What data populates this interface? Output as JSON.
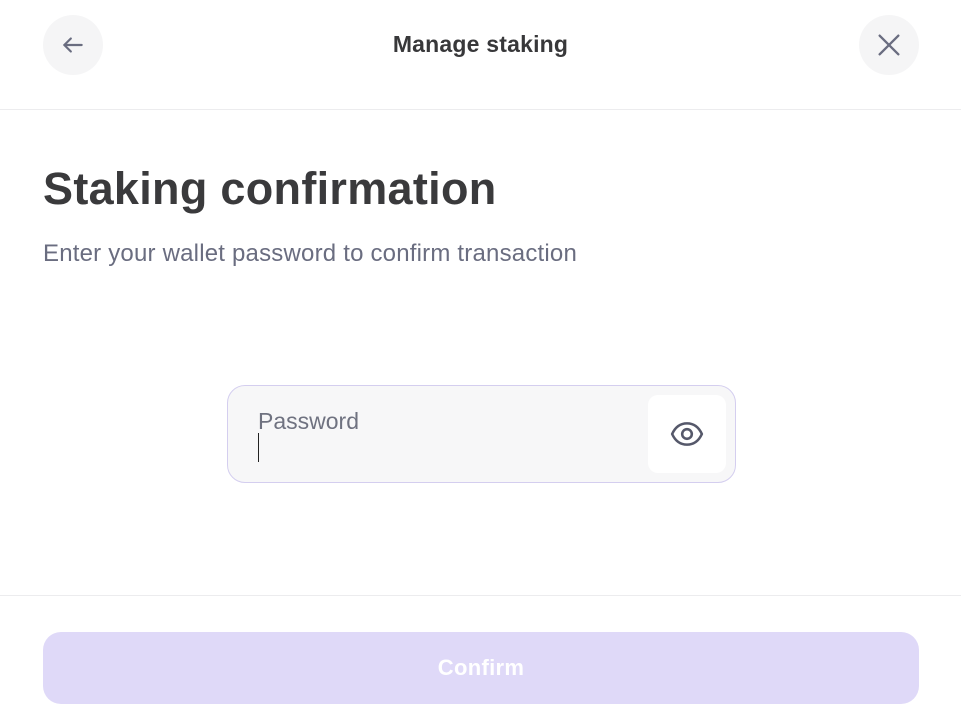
{
  "header": {
    "title": "Manage staking",
    "back_icon": "arrow-left-icon",
    "close_icon": "close-icon"
  },
  "main": {
    "title": "Staking confirmation",
    "subtitle": "Enter your wallet password to confirm transaction"
  },
  "password": {
    "label": "Password",
    "value": "",
    "toggle_icon": "eye-icon"
  },
  "footer": {
    "confirm_label": "Confirm"
  },
  "colors": {
    "accent_disabled": "#dfd9f8",
    "input_border": "#d4ceef",
    "subtitle_text": "#6a6d80"
  }
}
